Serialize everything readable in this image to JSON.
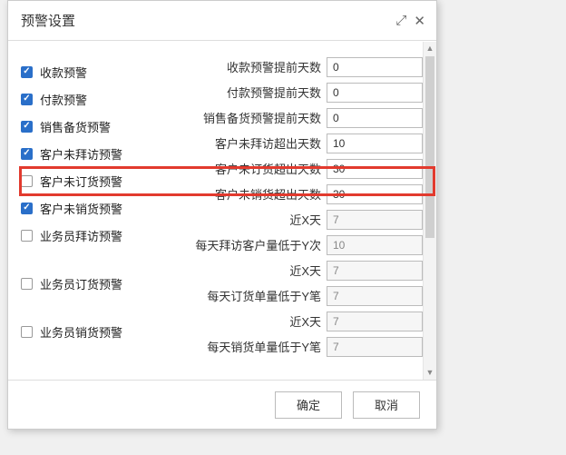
{
  "dialog": {
    "title": "预警设置",
    "ok": "确定",
    "cancel": "取消"
  },
  "left": {
    "items": [
      {
        "label": "收款预警",
        "checked": true
      },
      {
        "label": "付款预警",
        "checked": true
      },
      {
        "label": "销售备货预警",
        "checked": true
      },
      {
        "label": "客户未拜访预警",
        "checked": true
      },
      {
        "label": "客户未订货预警",
        "checked": false
      },
      {
        "label": "客户未销货预警",
        "checked": true
      },
      {
        "label": "业务员拜访预警",
        "checked": false
      },
      {
        "label": "业务员订货预警",
        "checked": false
      },
      {
        "label": "业务员销货预警",
        "checked": false
      }
    ]
  },
  "right": {
    "fields": [
      {
        "label": "收款预警提前天数",
        "value": "0"
      },
      {
        "label": "付款预警提前天数",
        "value": "0"
      },
      {
        "label": "销售备货预警提前天数",
        "value": "0"
      },
      {
        "label": "客户未拜访超出天数",
        "value": "10"
      },
      {
        "label": "客户未订货超出天数",
        "value": "30"
      },
      {
        "label": "客户未销货超出天数",
        "value": "30"
      },
      {
        "label": "近X天",
        "value": "7",
        "readonly": true
      },
      {
        "label": "每天拜访客户量低于Y次",
        "value": "10",
        "readonly": true
      },
      {
        "label": "近X天",
        "value": "7",
        "readonly": true
      },
      {
        "label": "每天订货单量低于Y笔",
        "value": "7",
        "readonly": true
      },
      {
        "label": "近X天",
        "value": "7",
        "readonly": true
      },
      {
        "label": "每天销货单量低于Y笔",
        "value": "7",
        "readonly": true
      }
    ]
  }
}
